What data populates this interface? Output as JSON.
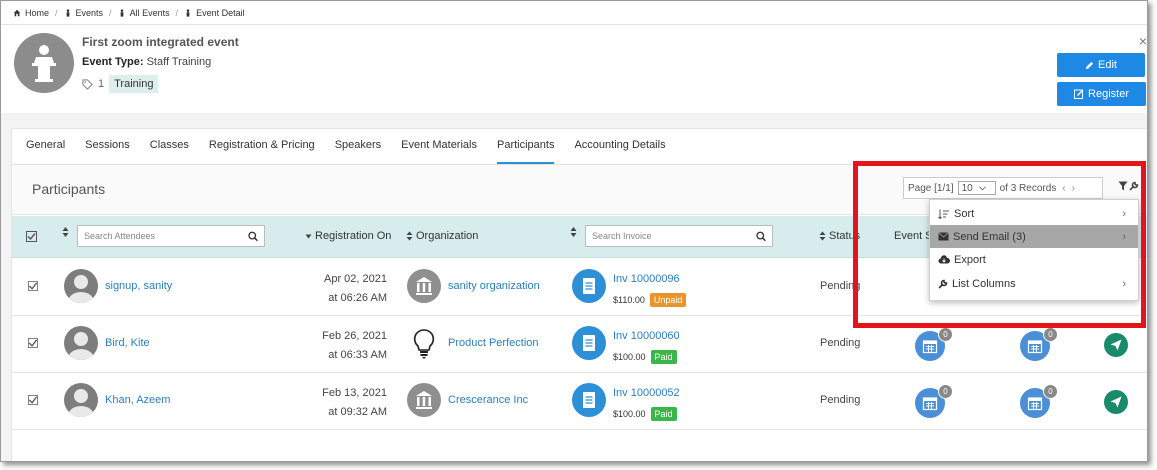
{
  "breadcrumb": [
    "Home",
    "Events",
    "All Events",
    "Event Detail"
  ],
  "event": {
    "title": "First zoom integrated event",
    "type_label": "Event Type:",
    "type_value": "Staff Training",
    "tag_count": "1",
    "tag": "Training"
  },
  "header_buttons": {
    "edit": "Edit",
    "register": "Register"
  },
  "tabs": [
    {
      "label": "General"
    },
    {
      "label": "Sessions"
    },
    {
      "label": "Classes"
    },
    {
      "label": "Registration & Pricing"
    },
    {
      "label": "Speakers"
    },
    {
      "label": "Event Materials"
    },
    {
      "label": "Participants",
      "active": true
    },
    {
      "label": "Accounting Details"
    }
  ],
  "section": {
    "title": "Participants",
    "page_label": "Page [1/1]",
    "page_size": "10",
    "records": "of 3 Records"
  },
  "table": {
    "search_attendees_placeholder": "Search Attendees",
    "col_registration": "Registration On",
    "col_organization": "Organization",
    "search_invoice_placeholder": "Search Invoice",
    "col_status": "Status",
    "col_event": "Event S"
  },
  "rows": [
    {
      "name": "signup, sanity",
      "date": "Apr 02, 2021",
      "time": "at 06:26 AM",
      "org": "sanity organization",
      "org_icon": "bank-icon",
      "invoice": "Inv 10000096",
      "amount": "$110.00",
      "payment": "Unpaid",
      "status": "Pending"
    },
    {
      "name": "Bird, Kite",
      "date": "Feb 26, 2021",
      "time": "at 06:33 AM",
      "org": "Product Perfection",
      "org_icon": "lightbulb-icon",
      "invoice": "Inv 10000060",
      "amount": "$100.00",
      "payment": "Paid",
      "status": "Pending",
      "count1": "0",
      "count2": "0"
    },
    {
      "name": "Khan, Azeem",
      "date": "Feb 13, 2021",
      "time": "at 09:32 AM",
      "org": "Crescerance Inc",
      "org_icon": "bank-icon",
      "invoice": "Inv 10000052",
      "amount": "$100.00",
      "payment": "Paid",
      "status": "Pending",
      "count1": "0",
      "count2": "0"
    }
  ],
  "dropdown": [
    {
      "label": "Sort",
      "icon": "sort-icon"
    },
    {
      "label": "Send Email (3)",
      "icon": "envelope-icon",
      "highlighted": true
    },
    {
      "label": "Export",
      "icon": "cloud-download-icon"
    },
    {
      "label": "List Columns",
      "icon": "wrench-icon"
    }
  ],
  "colors": {
    "primary": "#1e88e5",
    "active_tab": "#2d8fd6",
    "table_head": "#d7ecec",
    "highlight_border": "#e3141a",
    "paid": "#3cb64a",
    "unpaid": "#e8952b"
  }
}
